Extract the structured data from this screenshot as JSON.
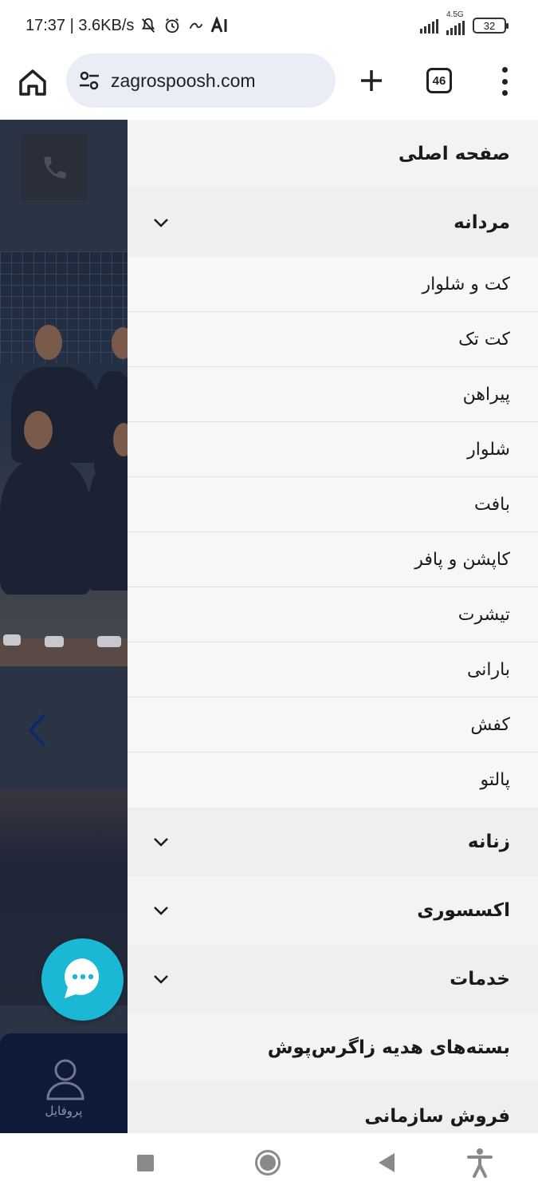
{
  "status_bar": {
    "time_speed": "17:37 | 3.6KB/s",
    "network_label": "4.5G",
    "battery": "32",
    "icons": [
      "bell-off-icon",
      "alarm-icon",
      "cast-icon",
      "ai-icon",
      "signal-icon",
      "signal-4.5g-icon",
      "battery-icon"
    ]
  },
  "browser": {
    "url": "zagrospoosh.com",
    "tab_count": "46",
    "icons": [
      "home-icon",
      "site-settings-icon",
      "plus-icon",
      "tabs-icon",
      "more-vert-icon"
    ]
  },
  "page": {
    "profile_label": "پروفایل",
    "icons": [
      "phone-icon",
      "chevron-left-icon",
      "user-icon",
      "chat-icon"
    ]
  },
  "menu": {
    "home": "صفحه اصلی",
    "men": {
      "label": "مردانه",
      "expanded": true,
      "items": [
        "کت و شلوار",
        "کت تک",
        "پیراهن",
        "شلوار",
        "بافت",
        "کاپشن و پافر",
        "تیشرت",
        "بارانی",
        "کفش",
        "پالتو"
      ]
    },
    "women": "زنانه",
    "accessory": "اکسسوری",
    "services": "خدمات",
    "gift_packages": "بسته‌های هدیه زاگرس‌پوش",
    "corporate_sales": "فروش سازمانی"
  },
  "colors": {
    "chat_fab": "#1ab8d4",
    "url_bar": "#e9eef6",
    "menu_bg": "#f3f3f3",
    "profile_card": "#0f1a3a"
  }
}
